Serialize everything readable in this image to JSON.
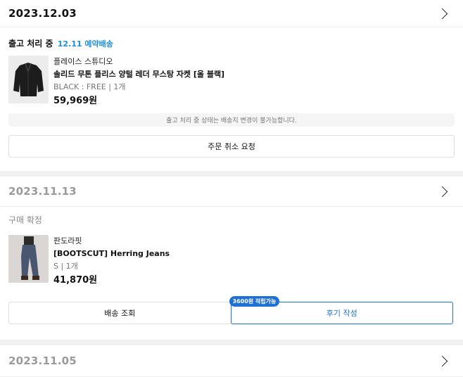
{
  "orders": [
    {
      "date": "2023.12.03",
      "status": "출고 처리 중",
      "eta": "12.11 예약배송",
      "product": {
        "brand": "플레이스 스튜디오",
        "name": "솔리드 무톤 플리스 양털 레더 무스탕 자켓 [올 블랙]",
        "option": "BLACK : FREE  |  1개",
        "price": "59,969원"
      },
      "notice": "출고 처리 중 상태는 배송지 변경이 불가능합니다.",
      "action": "주문 취소 요청"
    },
    {
      "date": "2023.11.13",
      "status": "구매 확정",
      "product": {
        "brand": "판도라핏",
        "name": "[BOOTSCUT] Herring Jeans",
        "option": "S  |  1개",
        "price": "41,870원"
      },
      "actions": {
        "delivery": "배송 조회",
        "review": "후기 작성",
        "review_badge": "3600원 적립가능"
      }
    },
    {
      "date": "2023.11.05"
    }
  ],
  "colors": {
    "accent_blue": "#1e6fd6",
    "eta_blue": "#1e8fd6"
  }
}
